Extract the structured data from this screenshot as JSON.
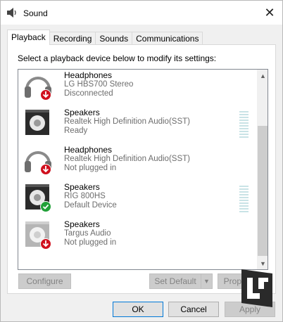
{
  "window": {
    "title": "Sound",
    "close_label": "✕"
  },
  "tabs": [
    {
      "label": "Playback",
      "active": true
    },
    {
      "label": "Recording",
      "active": false
    },
    {
      "label": "Sounds",
      "active": false
    },
    {
      "label": "Communications",
      "active": false
    }
  ],
  "panel": {
    "instruction": "Select a playback device below to modify its settings:"
  },
  "devices": [
    {
      "name": "Headphones",
      "model": "LG HBS700 Stereo",
      "status": "Disconnected",
      "icon": "headphones-icon",
      "badge": "red-down-arrow"
    },
    {
      "name": "Speakers",
      "model": "Realtek High Definition Audio(SST)",
      "status": "Ready",
      "icon": "speaker-icon",
      "badge": "none"
    },
    {
      "name": "Headphones",
      "model": "Realtek High Definition Audio(SST)",
      "status": "Not plugged in",
      "icon": "headphones-icon",
      "badge": "red-down-arrow"
    },
    {
      "name": "Speakers",
      "model": "RIG 800HS",
      "status": "Default Device",
      "icon": "speaker-icon",
      "badge": "green-check"
    },
    {
      "name": "Speakers",
      "model": "Targus Audio",
      "status": "Not plugged in",
      "icon": "speaker-icon",
      "badge": "red-down-arrow"
    }
  ],
  "buttons": {
    "configure": "Configure",
    "set_default": "Set Default",
    "set_default_arrow": "▼",
    "properties": "Properties",
    "ok": "OK",
    "cancel": "Cancel",
    "apply": "Apply"
  },
  "scrollbar": {
    "up": "▲",
    "down": "▼"
  },
  "colors": {
    "accent_blue": "#0078d7",
    "badge_red": "#d0101e",
    "badge_green": "#21a038",
    "level_meter": "#c9e3e6"
  }
}
